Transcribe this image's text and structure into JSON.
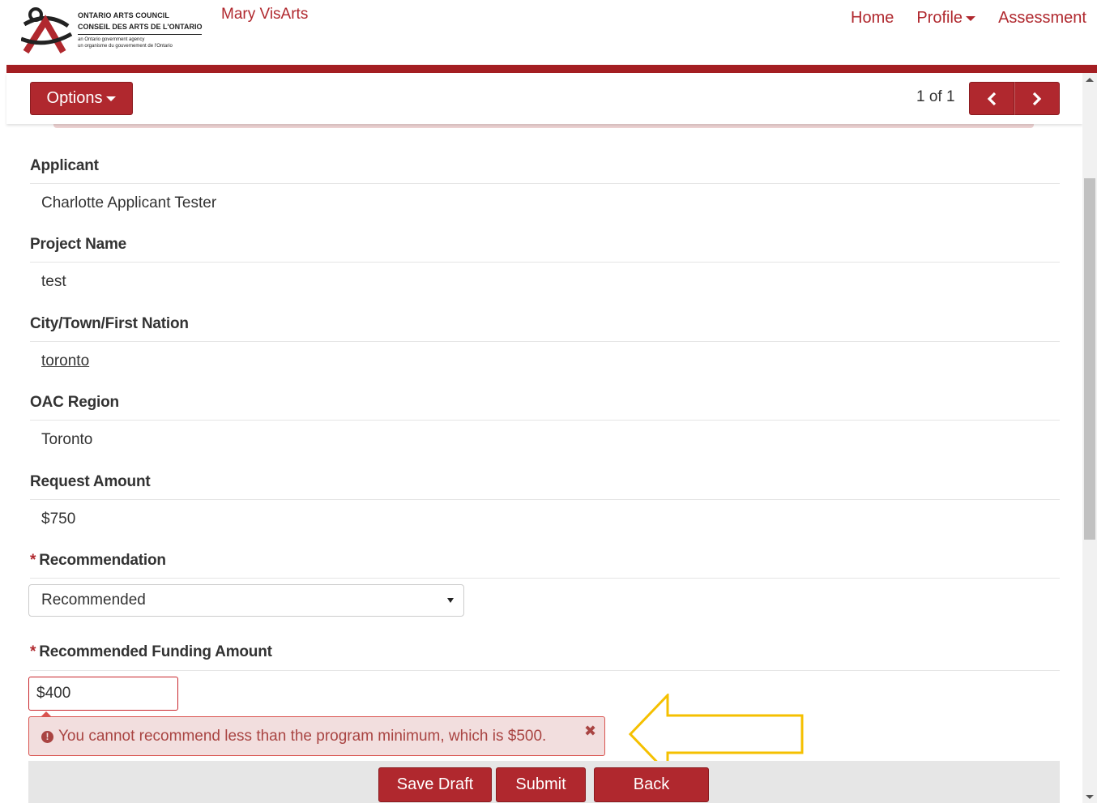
{
  "header": {
    "logo": {
      "line1": "ONTARIO ARTS COUNCIL",
      "line2": "CONSEIL DES ARTS DE L'ONTARIO",
      "line3": "an Ontario government agency",
      "line4": "un organisme du gouvernement de l'Ontario"
    },
    "user_name": "Mary VisArts",
    "nav": {
      "home": "Home",
      "profile": "Profile",
      "assessment": "Assessment"
    }
  },
  "toolbar": {
    "options_label": "Options",
    "pager_text": "1 of 1",
    "prev_icon": "chevron-left-icon",
    "next_icon": "chevron-right-icon"
  },
  "fields": {
    "applicant": {
      "label": "Applicant",
      "value": "Charlotte Applicant Tester"
    },
    "project_name": {
      "label": "Project Name",
      "value": "test"
    },
    "city": {
      "label": "City/Town/First Nation",
      "value": "toronto"
    },
    "region": {
      "label": "OAC Region",
      "value": "Toronto"
    },
    "request_amount": {
      "label": "Request Amount",
      "value": "$750"
    },
    "recommendation": {
      "label": "Recommendation",
      "required_mark": "*",
      "selected": "Recommended"
    },
    "funding_amount": {
      "label": "Recommended Funding Amount",
      "required_mark": "*",
      "value": "$400"
    }
  },
  "error": {
    "icon": "exclamation-circle-icon",
    "message": "You cannot recommend less than the program minimum, which is $500.",
    "close_icon": "close-icon"
  },
  "footer": {
    "save_draft": "Save Draft",
    "submit": "Submit",
    "back": "Back"
  },
  "colors": {
    "brand_red": "#b0282e",
    "error_bg": "#f2dede",
    "error_text": "#a94442",
    "callout_arrow": "#f5c000"
  }
}
